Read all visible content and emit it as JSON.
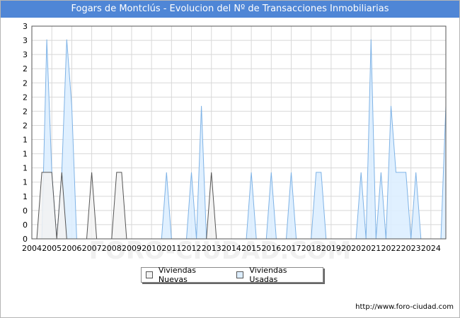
{
  "header": {
    "title": "Fogars de Montclús - Evolucion del Nº de Transacciones Inmobiliarias"
  },
  "footer": {
    "url": "http://www.foro-ciudad.com"
  },
  "legend": {
    "nuevas": "Viviendas Nuevas",
    "usadas": "Viviendas Usadas"
  },
  "watermark": "FORO-CIUDAD.COM",
  "colors": {
    "title_bg": "#4f86d6",
    "nuevas_fill": "#f2f2f2",
    "nuevas_stroke": "#555555",
    "usadas_fill": "#ddeeff",
    "usadas_stroke": "#7fb3e6",
    "grid": "#d8d8d8"
  },
  "chart_data": {
    "type": "area",
    "title": "Fogars de Montclús - Evolucion del Nº de Transacciones Inmobiliarias",
    "x_ticks": [
      "2004",
      "2005",
      "2006",
      "2007",
      "2008",
      "2009",
      "2010",
      "2011",
      "2012",
      "2013",
      "2014",
      "2015",
      "2016",
      "2017",
      "2018",
      "2019",
      "2020",
      "2021",
      "2022",
      "2023",
      "2024"
    ],
    "y_tick_labels": [
      "0",
      "0",
      "0",
      "1",
      "1",
      "1",
      "1",
      "1",
      "2",
      "2",
      "2",
      "2",
      "2",
      "3",
      "3",
      "3"
    ],
    "ylim": [
      0,
      3.2
    ],
    "xlim": [
      2004,
      2024.75
    ],
    "grid": true,
    "legend_position": "bottom-center",
    "series": [
      {
        "name": "Viviendas Nuevas",
        "points": [
          [
            2004.25,
            0
          ],
          [
            2004.5,
            1
          ],
          [
            2004.75,
            1
          ],
          [
            2005.0,
            1
          ],
          [
            2005.25,
            0
          ],
          [
            2005.5,
            1
          ],
          [
            2005.75,
            0
          ],
          [
            2006.75,
            0
          ],
          [
            2007.0,
            1
          ],
          [
            2007.25,
            0
          ],
          [
            2008.0,
            0
          ],
          [
            2008.25,
            1
          ],
          [
            2008.5,
            1
          ],
          [
            2008.75,
            0
          ],
          [
            2012.75,
            0
          ],
          [
            2013.0,
            1
          ],
          [
            2013.25,
            0
          ]
        ]
      },
      {
        "name": "Viviendas Usadas",
        "points": [
          [
            2004.5,
            0
          ],
          [
            2004.75,
            3
          ],
          [
            2005.0,
            1
          ],
          [
            2005.25,
            0
          ],
          [
            2005.5,
            1
          ],
          [
            2005.75,
            3
          ],
          [
            2006.0,
            2
          ],
          [
            2006.25,
            0
          ],
          [
            2010.5,
            0
          ],
          [
            2010.75,
            1
          ],
          [
            2011.0,
            0
          ],
          [
            2011.75,
            0
          ],
          [
            2012.0,
            1
          ],
          [
            2012.25,
            0
          ],
          [
            2012.5,
            2
          ],
          [
            2012.75,
            0
          ],
          [
            2014.75,
            0
          ],
          [
            2015.0,
            1
          ],
          [
            2015.25,
            0
          ],
          [
            2015.75,
            0
          ],
          [
            2016.0,
            1
          ],
          [
            2016.25,
            0
          ],
          [
            2016.75,
            0
          ],
          [
            2017.0,
            1
          ],
          [
            2017.25,
            0
          ],
          [
            2018.0,
            0
          ],
          [
            2018.25,
            1
          ],
          [
            2018.5,
            1
          ],
          [
            2018.75,
            0
          ],
          [
            2020.25,
            0
          ],
          [
            2020.5,
            1
          ],
          [
            2020.75,
            0
          ],
          [
            2021.0,
            3
          ],
          [
            2021.25,
            0
          ],
          [
            2021.5,
            1
          ],
          [
            2021.75,
            0
          ],
          [
            2022.0,
            2
          ],
          [
            2022.25,
            1
          ],
          [
            2022.5,
            1
          ],
          [
            2022.75,
            1
          ],
          [
            2023.0,
            0
          ],
          [
            2023.25,
            1
          ],
          [
            2023.5,
            0
          ],
          [
            2024.5,
            0
          ],
          [
            2024.75,
            2
          ]
        ]
      }
    ]
  }
}
